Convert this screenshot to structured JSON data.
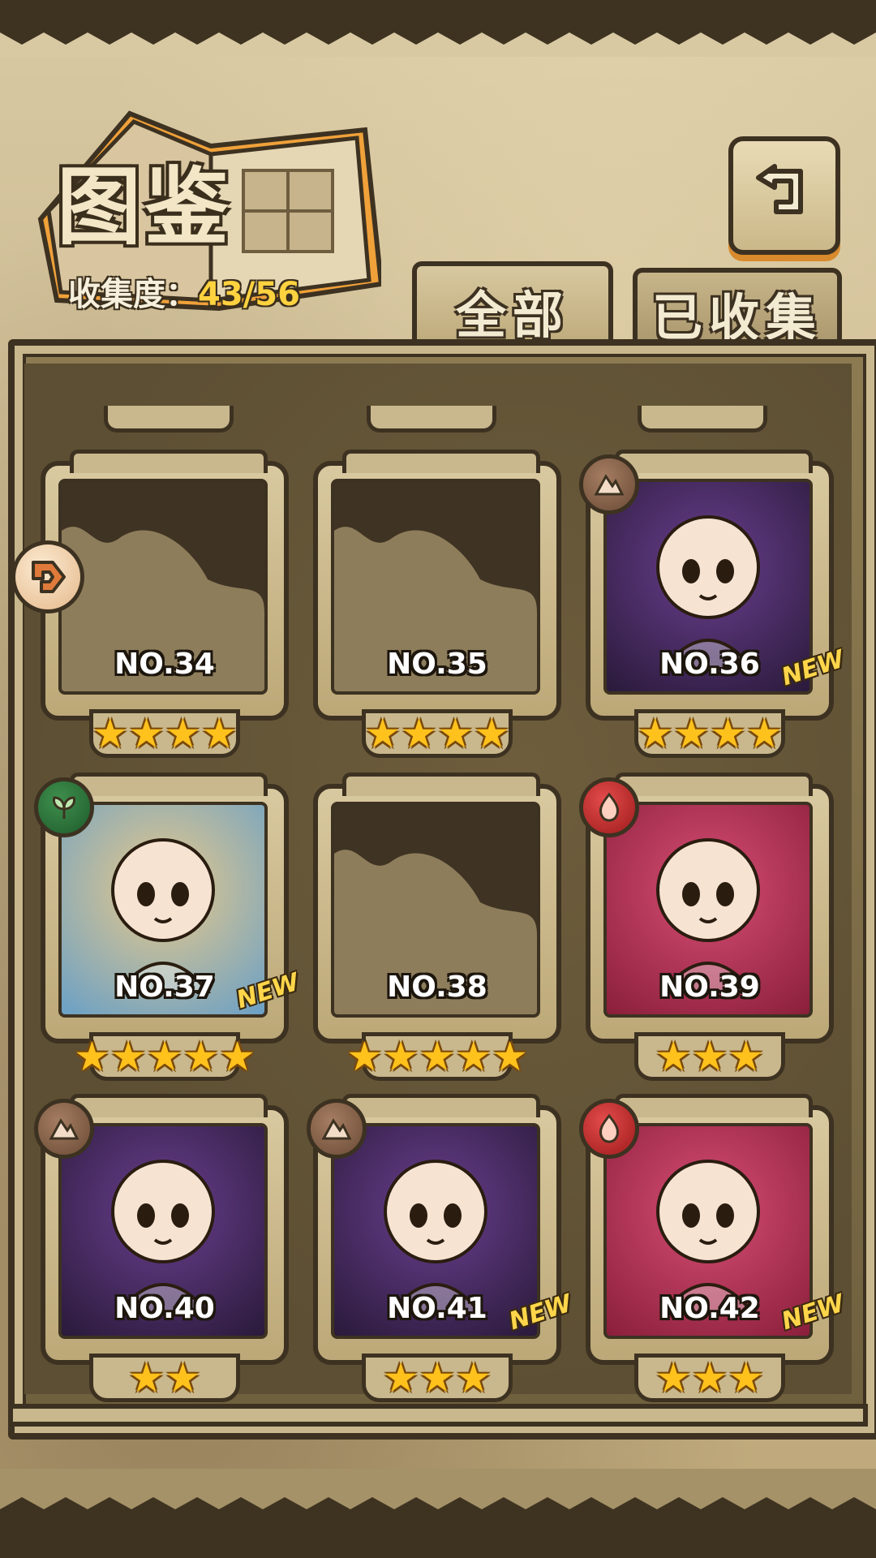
{
  "header": {
    "title": "图鉴",
    "collection_label": "收集度：",
    "collection_value": "43/56"
  },
  "tabs": [
    {
      "label": "全部",
      "active": true
    },
    {
      "label": "已收集",
      "active": false
    }
  ],
  "cards": [
    {
      "no": "NO.34",
      "stars": 4,
      "unlocked": false,
      "element": null,
      "new": false
    },
    {
      "no": "NO.35",
      "stars": 4,
      "unlocked": false,
      "element": null,
      "new": false
    },
    {
      "no": "NO.36",
      "stars": 4,
      "unlocked": true,
      "element": "earth",
      "new": true
    },
    {
      "no": "NO.37",
      "stars": 5,
      "unlocked": true,
      "element": "leaf",
      "new": true
    },
    {
      "no": "NO.38",
      "stars": 5,
      "unlocked": false,
      "element": null,
      "new": false
    },
    {
      "no": "NO.39",
      "stars": 3,
      "unlocked": true,
      "element": "fire",
      "new": false
    },
    {
      "no": "NO.40",
      "stars": 2,
      "unlocked": true,
      "element": "earth",
      "new": false
    },
    {
      "no": "NO.41",
      "stars": 3,
      "unlocked": true,
      "element": "earth",
      "new": true
    },
    {
      "no": "NO.42",
      "stars": 3,
      "unlocked": true,
      "element": "fire",
      "new": true
    }
  ],
  "new_label": "NEW",
  "icons": {
    "back": "back-arrow-icon",
    "side": "arrow-right-icon",
    "star": "★"
  },
  "colors": {
    "star": "#ffc21c",
    "new": "#ffd64a",
    "collection_value": "#ffd23f",
    "earth": "#8a644a",
    "leaf": "#2e7a3d",
    "fire": "#c72a2a"
  }
}
